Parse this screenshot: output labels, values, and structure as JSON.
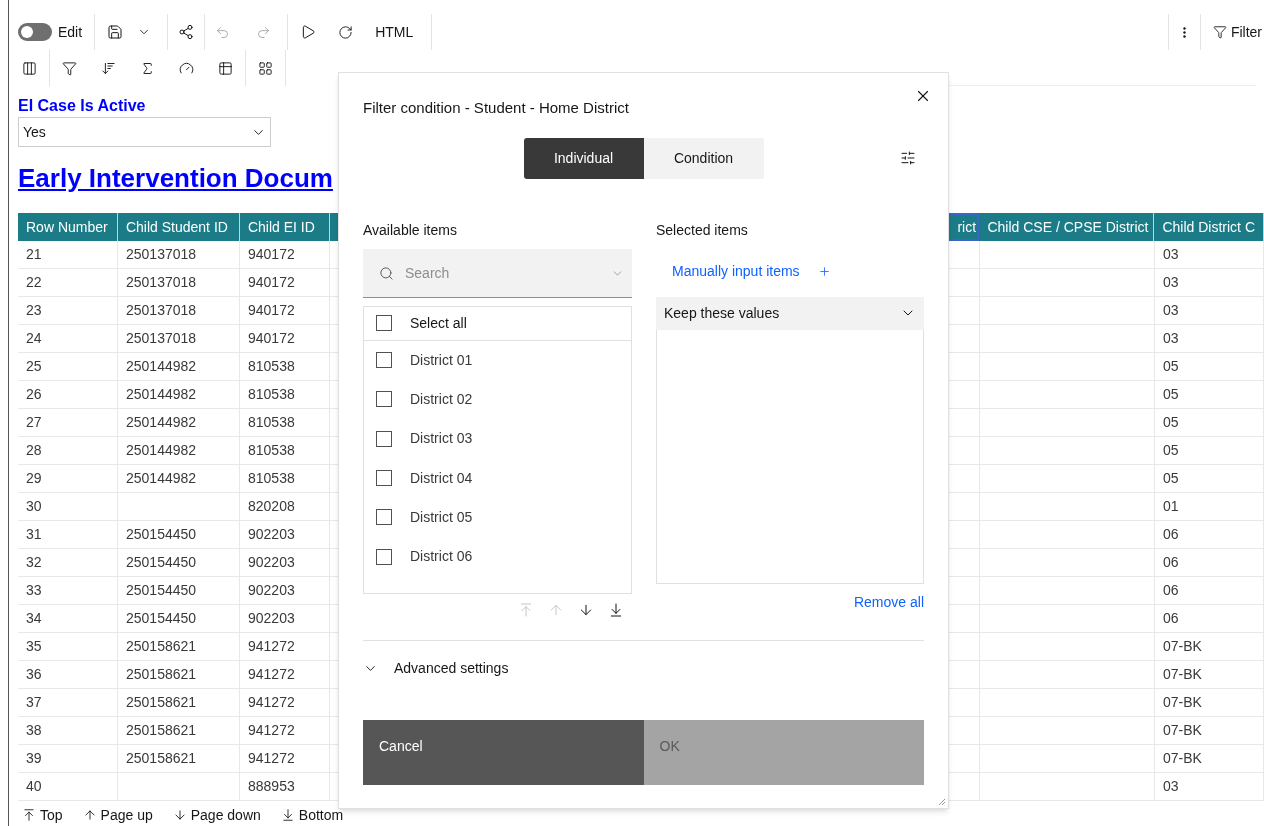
{
  "toolbar": {
    "edit_toggle": {
      "label": "Edit",
      "on": false
    },
    "html_button": "HTML",
    "filter_button": "Filter"
  },
  "prompt": {
    "label": "EI Case Is Active",
    "value": "Yes"
  },
  "report_title": "Early Intervention Docum",
  "table": {
    "columns": [
      {
        "label": "Row Number",
        "selected": false
      },
      {
        "label": "Child Student ID",
        "selected": false
      },
      {
        "label": "Child EI ID",
        "selected": false
      },
      {
        "label": "rict",
        "selected": true
      },
      {
        "label": "Child CSE / CPSE District",
        "selected": false
      },
      {
        "label": "Child District C",
        "selected": false
      }
    ],
    "rows": [
      {
        "row_number": "21",
        "student_id": "250137018",
        "ei_id": "940172",
        "district_code": "03"
      },
      {
        "row_number": "22",
        "student_id": "250137018",
        "ei_id": "940172",
        "district_code": "03"
      },
      {
        "row_number": "23",
        "student_id": "250137018",
        "ei_id": "940172",
        "district_code": "03"
      },
      {
        "row_number": "24",
        "student_id": "250137018",
        "ei_id": "940172",
        "district_code": "03"
      },
      {
        "row_number": "25",
        "student_id": "250144982",
        "ei_id": "810538",
        "district_code": "05"
      },
      {
        "row_number": "26",
        "student_id": "250144982",
        "ei_id": "810538",
        "district_code": "05"
      },
      {
        "row_number": "27",
        "student_id": "250144982",
        "ei_id": "810538",
        "district_code": "05"
      },
      {
        "row_number": "28",
        "student_id": "250144982",
        "ei_id": "810538",
        "district_code": "05"
      },
      {
        "row_number": "29",
        "student_id": "250144982",
        "ei_id": "810538",
        "district_code": "05"
      },
      {
        "row_number": "30",
        "ei_id": "820208",
        "district_code": "01"
      },
      {
        "row_number": "31",
        "student_id": "250154450",
        "ei_id": "902203",
        "district_code": "06"
      },
      {
        "row_number": "32",
        "student_id": "250154450",
        "ei_id": "902203",
        "district_code": "06"
      },
      {
        "row_number": "33",
        "student_id": "250154450",
        "ei_id": "902203",
        "district_code": "06"
      },
      {
        "row_number": "34",
        "student_id": "250154450",
        "ei_id": "902203",
        "district_code": "06"
      },
      {
        "row_number": "35",
        "student_id": "250158621",
        "ei_id": "941272",
        "district_code": "07-BK"
      },
      {
        "row_number": "36",
        "student_id": "250158621",
        "ei_id": "941272",
        "district_code": "07-BK"
      },
      {
        "row_number": "37",
        "student_id": "250158621",
        "ei_id": "941272",
        "district_code": "07-BK"
      },
      {
        "row_number": "38",
        "student_id": "250158621",
        "ei_id": "941272",
        "district_code": "07-BK"
      },
      {
        "row_number": "39",
        "student_id": "250158621",
        "ei_id": "941272",
        "district_code": "07-BK"
      },
      {
        "row_number": "40",
        "ei_id": "888953",
        "district_code": "03"
      }
    ]
  },
  "page_nav": [
    {
      "kind": "top",
      "label": "Top"
    },
    {
      "kind": "up",
      "label": "Page up"
    },
    {
      "kind": "down",
      "label": "Page down"
    },
    {
      "kind": "bottom",
      "label": "Bottom"
    }
  ],
  "modal": {
    "title": "Filter condition - Student - Home District",
    "tabs": [
      {
        "label": "Individual",
        "selected": true
      },
      {
        "label": "Condition",
        "selected": false
      }
    ],
    "available_label": "Available items",
    "search_placeholder": "Search",
    "select_all": {
      "label": "Select all",
      "checked": false
    },
    "items": [
      {
        "label": "District 01",
        "checked": false
      },
      {
        "label": "District 02",
        "checked": false
      },
      {
        "label": "District 03",
        "checked": false
      },
      {
        "label": "District 04",
        "checked": false
      },
      {
        "label": "District 05",
        "checked": false
      },
      {
        "label": "District 06",
        "checked": false
      }
    ],
    "move_buttons": [
      {
        "kind": "top",
        "disabled": true
      },
      {
        "kind": "up",
        "disabled": true
      },
      {
        "kind": "down",
        "disabled": false
      },
      {
        "kind": "bottom",
        "disabled": false
      }
    ],
    "selected_label": "Selected items",
    "manual_input": "Manually input items",
    "mode_select": "Keep these values",
    "remove_all": "Remove all",
    "advanced": {
      "label": "Advanced settings",
      "expanded": false
    },
    "cancel": "Cancel",
    "ok": {
      "label": "OK",
      "disabled": true
    }
  }
}
